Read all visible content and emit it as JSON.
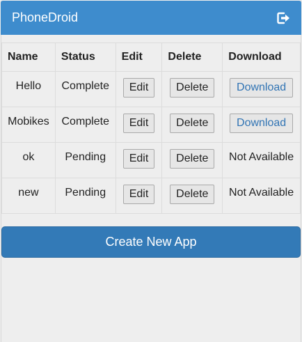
{
  "app": {
    "title": "PhoneDroid"
  },
  "header": {
    "logout_icon": "logout-icon"
  },
  "table": {
    "columns": [
      "Name",
      "Status",
      "Edit",
      "Delete",
      "Download"
    ],
    "rows": [
      {
        "name": "Hello",
        "status": "Complete",
        "edit": "Edit",
        "delete": "Delete",
        "download": "Download"
      },
      {
        "name": "Mobikes",
        "status": "Complete",
        "edit": "Edit",
        "delete": "Delete",
        "download": "Download"
      },
      {
        "name": "ok",
        "status": "Pending",
        "edit": "Edit",
        "delete": "Delete",
        "download": "Not Available"
      },
      {
        "name": "new",
        "status": "Pending",
        "edit": "Edit",
        "delete": "Delete",
        "download": "Not Available"
      }
    ]
  },
  "actions": {
    "create_label": "Create New App"
  },
  "colors": {
    "navbar": "#3e8ccd",
    "primary_button": "#337ab7",
    "link": "#3174b4",
    "background": "#eeeeee"
  }
}
